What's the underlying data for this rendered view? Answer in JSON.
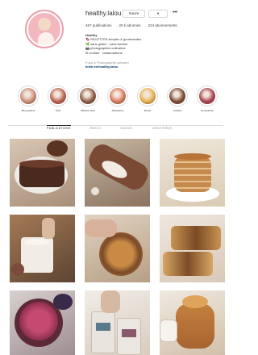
{
  "profile": {
    "username": "healthy.lalou",
    "follow_button": "Suivre",
    "more_button": "▾",
    "dots": "•••",
    "stats": [
      "467 publications",
      "20 k abonnés",
      "224 abonnements"
    ],
    "bio_lines": [
      "Healthy",
      "🍫 RECETTES simples & gourmandes",
      "🌿 sans gluten · sans lactose",
      "📷 photographies culinaires",
      "✉ contact · collaborations"
    ],
    "bio_note": "Food & Photographie culinaire",
    "bio_link": "linktr.ee/healthy.lalou"
  },
  "highlights": [
    {
      "label": "Mes goûters",
      "color": "#c98f7a"
    },
    {
      "label": "Noël",
      "color": "#b9624f"
    },
    {
      "label": "Bûches Noël",
      "color": "#8c5a47"
    },
    {
      "label": "Pâtisseries",
      "color": "#d77a5f"
    },
    {
      "label": "Bowls",
      "color": "#e7b24e"
    },
    {
      "label": "Cookies",
      "color": "#7a4a33"
    },
    {
      "label": "Nouveautés",
      "color": "#a8424e"
    }
  ],
  "tabs": [
    "PUBLICATIONS",
    "REELS",
    "VIDÉOS",
    "IDENTIFIÉ(E)"
  ]
}
